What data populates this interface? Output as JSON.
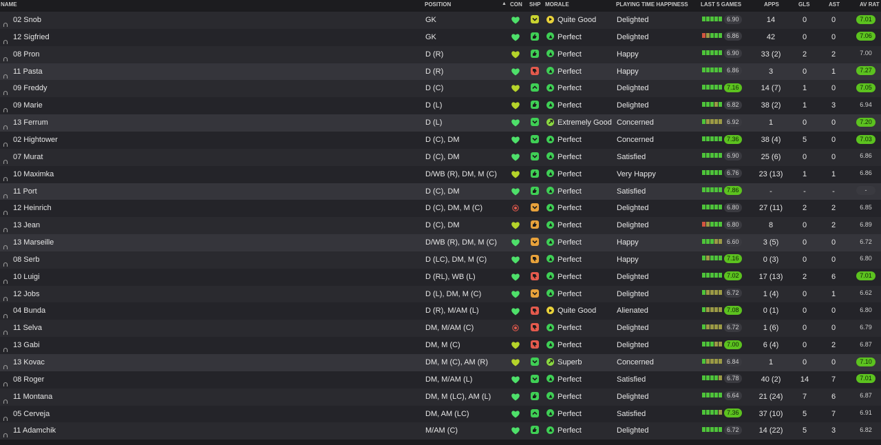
{
  "header": {
    "name": "NAME",
    "position": "POSITION",
    "sort_arrow": "▲",
    "con": "CON",
    "shp": "SHP",
    "morale": "MORALE",
    "pth": "PLAYING TIME HAPPINESS",
    "last5": "LAST 5 GAMES",
    "apps": "APPS",
    "gls": "GLS",
    "ast": "AST",
    "avrat": "AV RAT"
  },
  "colors": {
    "green": "#5cc21f",
    "yellow_green": "#b6d42a",
    "olive": "#8c8f3c",
    "orange": "#e0a13a",
    "red": "#e45a4d",
    "accent_bright_green": "#4ee06a"
  },
  "rows": [
    {
      "name": "02 Snob",
      "pos": "GK",
      "con": "green",
      "shp": "yellow",
      "shp_icon": "down",
      "mor": "Quite Good",
      "mor_icon": "right-arrow",
      "mor_color": "yellow",
      "pth": "Delighted",
      "form": [
        "g",
        "g",
        "g",
        "g",
        "g"
      ],
      "rating": "6.90",
      "rating_good": false,
      "apps": "14",
      "gls": "0",
      "ast": "0",
      "avr": "7.01",
      "avr_good": true
    },
    {
      "name": "12 Sigfried",
      "pos": "GK",
      "con": "green",
      "shp": "green",
      "shp_icon": "thumb",
      "mor": "Perfect",
      "mor_icon": "up-arrow",
      "mor_color": "green",
      "pth": "Delighted",
      "form": [
        "r",
        "o",
        "g",
        "g",
        "g"
      ],
      "rating": "6.86",
      "rating_good": false,
      "apps": "42",
      "gls": "0",
      "ast": "0",
      "avr": "7.06",
      "avr_good": true
    },
    {
      "name": "08 Pron",
      "pos": "D (R)",
      "con": "yellowgreen",
      "shp": "green",
      "shp_icon": "thumb",
      "mor": "Perfect",
      "mor_icon": "up-arrow",
      "mor_color": "green",
      "pth": "Happy",
      "form": [
        "g",
        "g",
        "g",
        "g",
        "g"
      ],
      "rating": "6.90",
      "rating_good": false,
      "apps": "33 (2)",
      "gls": "2",
      "ast": "2",
      "avr": "7.00",
      "avr_good": false
    },
    {
      "name": "11 Pasta",
      "pos": "D (R)",
      "con": "green",
      "shp": "red",
      "shp_icon": "thumb-down",
      "mor": "Perfect",
      "mor_icon": "up-arrow",
      "mor_color": "green",
      "pth": "Happy",
      "form": [
        "g",
        "g",
        "g",
        "g",
        "g"
      ],
      "rating": "6.86",
      "rating_good": false,
      "apps": "3",
      "gls": "0",
      "ast": "1",
      "avr": "7.27",
      "avr_good": true
    },
    {
      "name": "09 Freddy",
      "pos": "D (C)",
      "con": "yellowgreen",
      "shp": "green",
      "shp_icon": "up",
      "mor": "Perfect",
      "mor_icon": "up-arrow",
      "mor_color": "green",
      "pth": "Delighted",
      "form": [
        "g",
        "g",
        "g",
        "g",
        "g"
      ],
      "rating": "7.16",
      "rating_good": true,
      "apps": "14 (7)",
      "gls": "1",
      "ast": "0",
      "avr": "7.05",
      "avr_good": true
    },
    {
      "name": "09 Marie",
      "pos": "D (L)",
      "con": "yellowgreen",
      "shp": "green",
      "shp_icon": "thumb",
      "mor": "Perfect",
      "mor_icon": "up-arrow",
      "mor_color": "green",
      "pth": "Delighted",
      "form": [
        "g",
        "g",
        "g",
        "o",
        "g"
      ],
      "rating": "6.82",
      "rating_good": false,
      "apps": "38 (2)",
      "gls": "1",
      "ast": "3",
      "avr": "6.94",
      "avr_good": false
    },
    {
      "name": "13 Ferrum",
      "pos": "D (L)",
      "con": "green",
      "shp": "green",
      "shp_icon": "down",
      "mor": "Extremely Good",
      "mor_icon": "diag-arrow",
      "mor_color": "lightgreen",
      "pth": "Concerned",
      "form": [
        "g",
        "o",
        "o",
        "o",
        "o"
      ],
      "rating": "6.92",
      "rating_good": false,
      "apps": "1",
      "gls": "0",
      "ast": "0",
      "avr": "7.20",
      "avr_good": true
    },
    {
      "name": "02 Hightower",
      "pos": "D (C), DM",
      "con": "green",
      "shp": "green",
      "shp_icon": "down",
      "mor": "Perfect",
      "mor_icon": "up-arrow",
      "mor_color": "green",
      "pth": "Concerned",
      "form": [
        "g",
        "g",
        "g",
        "g",
        "g"
      ],
      "rating": "7.36",
      "rating_good": true,
      "apps": "38 (4)",
      "gls": "5",
      "ast": "0",
      "avr": "7.03",
      "avr_good": true
    },
    {
      "name": "07 Murat",
      "pos": "D (C), DM",
      "con": "green",
      "shp": "green",
      "shp_icon": "down",
      "mor": "Perfect",
      "mor_icon": "up-arrow",
      "mor_color": "green",
      "pth": "Satisfied",
      "form": [
        "g",
        "g",
        "g",
        "g",
        "g"
      ],
      "rating": "6.90",
      "rating_good": false,
      "apps": "25 (6)",
      "gls": "0",
      "ast": "0",
      "avr": "6.86",
      "avr_good": false
    },
    {
      "name": "10 Maximka",
      "pos": "D/WB (R), DM, M (C)",
      "con": "yellowgreen",
      "shp": "green",
      "shp_icon": "thumb",
      "mor": "Perfect",
      "mor_icon": "up-arrow",
      "mor_color": "green",
      "pth": "Very Happy",
      "form": [
        "g",
        "g",
        "g",
        "g",
        "g"
      ],
      "rating": "6.76",
      "rating_good": false,
      "apps": "23 (13)",
      "gls": "1",
      "ast": "1",
      "avr": "6.86",
      "avr_good": false
    },
    {
      "name": "11 Port",
      "pos": "D (C), DM",
      "con": "green",
      "shp": "green",
      "shp_icon": "thumb",
      "mor": "Perfect",
      "mor_icon": "up-arrow",
      "mor_color": "green",
      "pth": "Satisfied",
      "form": [
        "g",
        "g",
        "g",
        "g",
        "g"
      ],
      "rating": "7.86",
      "rating_good": true,
      "apps": "-",
      "gls": "-",
      "ast": "-",
      "avr": "-",
      "avr_good": false,
      "avr_dash": true
    },
    {
      "name": "12 Heinrich",
      "pos": "D (C), DM, M (C)",
      "con": "red",
      "shp": "orange",
      "shp_icon": "down",
      "mor": "Perfect",
      "mor_icon": "up-arrow",
      "mor_color": "green",
      "pth": "Delighted",
      "form": [
        "g",
        "g",
        "g",
        "g",
        "g"
      ],
      "rating": "6.80",
      "rating_good": false,
      "apps": "27 (11)",
      "gls": "2",
      "ast": "2",
      "avr": "6.85",
      "avr_good": false
    },
    {
      "name": "13 Jean",
      "pos": "D (C), DM",
      "con": "yellowgreen",
      "shp": "orange",
      "shp_icon": "thumb",
      "mor": "Perfect",
      "mor_icon": "up-arrow",
      "mor_color": "green",
      "pth": "Delighted",
      "form": [
        "r",
        "o",
        "g",
        "g",
        "g"
      ],
      "rating": "6.80",
      "rating_good": false,
      "apps": "8",
      "gls": "0",
      "ast": "2",
      "avr": "6.89",
      "avr_good": false
    },
    {
      "name": "13 Marseille",
      "pos": "D/WB (R), DM, M (C)",
      "con": "green",
      "shp": "orange",
      "shp_icon": "down",
      "mor": "Perfect",
      "mor_icon": "up-arrow",
      "mor_color": "green",
      "pth": "Happy",
      "form": [
        "g",
        "g",
        "g",
        "o",
        "o"
      ],
      "rating": "6.60",
      "rating_good": false,
      "apps": "3 (5)",
      "gls": "0",
      "ast": "0",
      "avr": "6.72",
      "avr_good": false
    },
    {
      "name": "08 Serb",
      "pos": "D (LC), DM, M (C)",
      "con": "green",
      "shp": "orange",
      "shp_icon": "thumb-down",
      "mor": "Perfect",
      "mor_icon": "up-arrow",
      "mor_color": "green",
      "pth": "Happy",
      "form": [
        "g",
        "o",
        "g",
        "g",
        "g"
      ],
      "rating": "7.16",
      "rating_good": true,
      "apps": "0 (3)",
      "gls": "0",
      "ast": "0",
      "avr": "6.80",
      "avr_good": false
    },
    {
      "name": "10 Luigi",
      "pos": "D (RL), WB (L)",
      "con": "green",
      "shp": "red",
      "shp_icon": "thumb-down",
      "mor": "Perfect",
      "mor_icon": "up-arrow",
      "mor_color": "green",
      "pth": "Delighted",
      "form": [
        "g",
        "g",
        "g",
        "g",
        "g"
      ],
      "rating": "7.02",
      "rating_good": true,
      "apps": "17 (13)",
      "gls": "2",
      "ast": "6",
      "avr": "7.01",
      "avr_good": true
    },
    {
      "name": "12 Jobs",
      "pos": "D (L), DM, M (C)",
      "con": "green",
      "shp": "orange",
      "shp_icon": "down",
      "mor": "Perfect",
      "mor_icon": "up-arrow",
      "mor_color": "green",
      "pth": "Delighted",
      "form": [
        "g",
        "o",
        "o",
        "o",
        "o"
      ],
      "rating": "6.72",
      "rating_good": false,
      "apps": "1 (4)",
      "gls": "0",
      "ast": "1",
      "avr": "6.62",
      "avr_good": false
    },
    {
      "name": "04 Bunda",
      "pos": "D (R), M/AM (L)",
      "con": "green",
      "shp": "red",
      "shp_icon": "thumb-down",
      "mor": "Quite Good",
      "mor_icon": "right-arrow",
      "mor_color": "yellow",
      "pth": "Alienated",
      "form": [
        "g",
        "o",
        "o",
        "o",
        "o"
      ],
      "rating": "7.08",
      "rating_good": true,
      "apps": "0 (1)",
      "gls": "0",
      "ast": "0",
      "avr": "6.80",
      "avr_good": false
    },
    {
      "name": "11 Selva",
      "pos": "DM, M/AM (C)",
      "con": "red",
      "shp": "red",
      "shp_icon": "thumb-down",
      "mor": "Perfect",
      "mor_icon": "up-arrow",
      "mor_color": "green",
      "pth": "Delighted",
      "form": [
        "g",
        "o",
        "o",
        "o",
        "o"
      ],
      "rating": "6.72",
      "rating_good": false,
      "apps": "1 (6)",
      "gls": "0",
      "ast": "0",
      "avr": "6.79",
      "avr_good": false
    },
    {
      "name": "13 Gabi",
      "pos": "DM, M (C)",
      "con": "yellowgreen",
      "shp": "red",
      "shp_icon": "thumb-down",
      "mor": "Perfect",
      "mor_icon": "up-arrow",
      "mor_color": "green",
      "pth": "Delighted",
      "form": [
        "g",
        "g",
        "g",
        "o",
        "o"
      ],
      "rating": "7.00",
      "rating_good": true,
      "apps": "6 (4)",
      "gls": "0",
      "ast": "2",
      "avr": "6.87",
      "avr_good": false
    },
    {
      "name": "13 Kovac",
      "pos": "DM, M (C), AM (R)",
      "con": "yellowgreen",
      "shp": "green",
      "shp_icon": "down",
      "mor": "Superb",
      "mor_icon": "diag-arrow",
      "mor_color": "lightgreen",
      "pth": "Concerned",
      "form": [
        "g",
        "o",
        "o",
        "o",
        "o"
      ],
      "rating": "6.84",
      "rating_good": false,
      "apps": "1",
      "gls": "0",
      "ast": "0",
      "avr": "7.10",
      "avr_good": true
    },
    {
      "name": "08 Roger",
      "pos": "DM, M/AM (L)",
      "con": "green",
      "shp": "green",
      "shp_icon": "down",
      "mor": "Perfect",
      "mor_icon": "up-arrow",
      "mor_color": "green",
      "pth": "Satisfied",
      "form": [
        "g",
        "g",
        "g",
        "g",
        "o"
      ],
      "rating": "6.78",
      "rating_good": false,
      "apps": "40 (2)",
      "gls": "14",
      "ast": "7",
      "avr": "7.01",
      "avr_good": true
    },
    {
      "name": "11 Montana",
      "pos": "DM, M (LC), AM (L)",
      "con": "green",
      "shp": "green",
      "shp_icon": "thumb",
      "mor": "Perfect",
      "mor_icon": "up-arrow",
      "mor_color": "green",
      "pth": "Delighted",
      "form": [
        "g",
        "g",
        "g",
        "g",
        "g"
      ],
      "rating": "6.64",
      "rating_good": false,
      "apps": "21 (24)",
      "gls": "7",
      "ast": "6",
      "avr": "6.87",
      "avr_good": false
    },
    {
      "name": "05 Cerveja",
      "pos": "DM, AM (LC)",
      "con": "green",
      "shp": "green",
      "shp_icon": "up",
      "mor": "Perfect",
      "mor_icon": "up-arrow",
      "mor_color": "green",
      "pth": "Satisfied",
      "form": [
        "g",
        "g",
        "g",
        "g",
        "o"
      ],
      "rating": "7.36",
      "rating_good": true,
      "apps": "37 (10)",
      "gls": "5",
      "ast": "7",
      "avr": "6.91",
      "avr_good": false
    },
    {
      "name": "11 Adamchik",
      "pos": "M/AM (C)",
      "con": "green",
      "shp": "green",
      "shp_icon": "thumb",
      "mor": "Perfect",
      "mor_icon": "up-arrow",
      "mor_color": "green",
      "pth": "Delighted",
      "form": [
        "g",
        "g",
        "g",
        "g",
        "g"
      ],
      "rating": "6.72",
      "rating_good": false,
      "apps": "14 (22)",
      "gls": "5",
      "ast": "3",
      "avr": "6.82",
      "avr_good": false
    }
  ]
}
